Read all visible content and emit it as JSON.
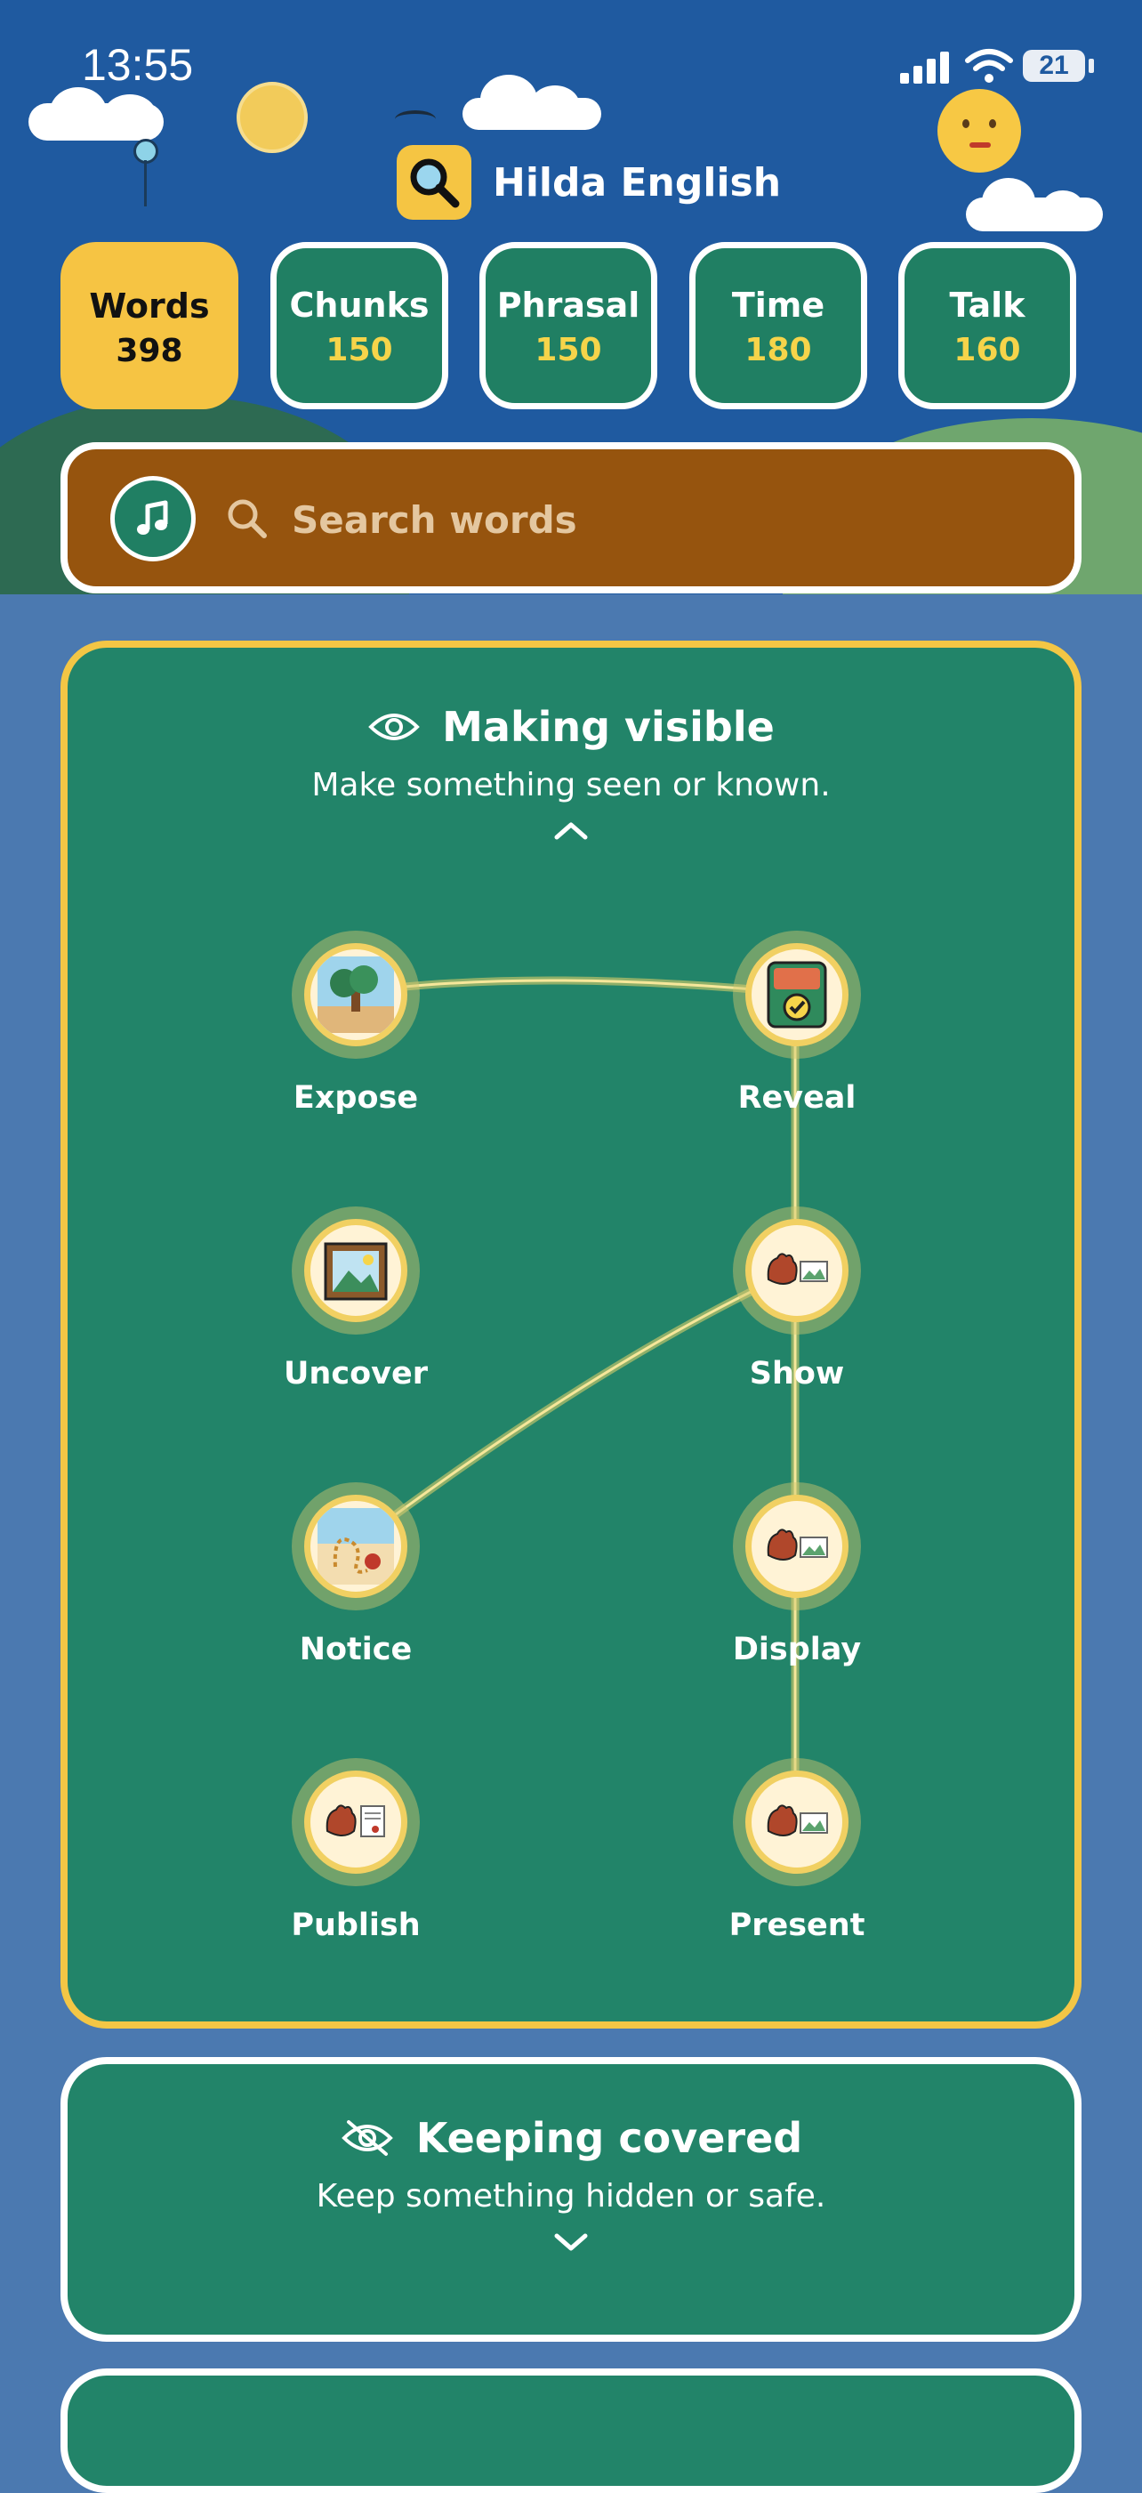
{
  "status": {
    "time": "13:55",
    "battery": "21"
  },
  "app": {
    "title": "Hilda English"
  },
  "tabs": [
    {
      "label": "Words",
      "count": "398",
      "active": true
    },
    {
      "label": "Chunks",
      "count": "150"
    },
    {
      "label": "Phrasal",
      "count": "150"
    },
    {
      "label": "Time",
      "count": "180"
    },
    {
      "label": "Talk",
      "count": "160"
    }
  ],
  "search": {
    "placeholder": "Search words",
    "value": ""
  },
  "groups": [
    {
      "title": "Making visible",
      "subtitle": "Make something seen or known.",
      "icon": "eye-icon",
      "expanded": true,
      "words": [
        "Expose",
        "Reveal",
        "Uncover",
        "Show",
        "Notice",
        "Display",
        "Publish",
        "Present"
      ]
    },
    {
      "title": "Keeping covered",
      "subtitle": "Keep something hidden or safe.",
      "icon": "eye-off-icon",
      "expanded": false
    }
  ],
  "colors": {
    "sky": "#1F5AA0",
    "background": "#4B79B0",
    "card": "#228469",
    "accent_yellow": "#F6C443",
    "search_bar": "#96540E"
  }
}
